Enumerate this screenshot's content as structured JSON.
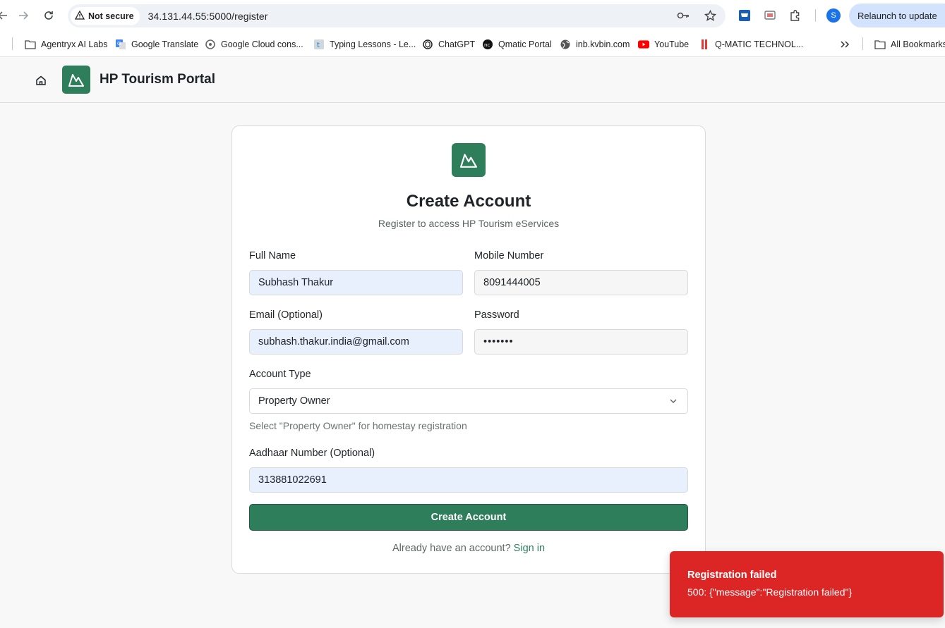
{
  "browser": {
    "security_label": "Not secure",
    "url": "34.131.44.55:5000/register",
    "profile_initial": "S",
    "relaunch_label": "Relaunch to update",
    "bookmarks": [
      {
        "label": "Agentryx AI Labs",
        "icon": "folder-icon"
      },
      {
        "label": "Google Translate",
        "icon": "translate-icon"
      },
      {
        "label": "Google Cloud cons...",
        "icon": "cloud-icon"
      },
      {
        "label": "Typing Lessons - Le...",
        "icon": "typing-icon"
      },
      {
        "label": "ChatGPT",
        "icon": "chatgpt-icon"
      },
      {
        "label": "Qmatic Portal",
        "icon": "qmatic-icon"
      },
      {
        "label": "inb.kvbin.com",
        "icon": "globe-icon"
      },
      {
        "label": "YouTube",
        "icon": "youtube-icon"
      },
      {
        "label": "Q-MATIC TECHNOL...",
        "icon": "qmatic-tech-icon"
      }
    ],
    "all_bookmarks_label": "All Bookmarks"
  },
  "header": {
    "title": "HP Tourism Portal"
  },
  "form": {
    "title": "Create Account",
    "subtitle": "Register to access HP Tourism eServices",
    "full_name_label": "Full Name",
    "full_name_value": "Subhash Thakur",
    "mobile_label": "Mobile Number",
    "mobile_value": "8091444005",
    "email_label": "Email (Optional)",
    "email_value": "subhash.thakur.india@gmail.com",
    "password_label": "Password",
    "password_value": "•••••••",
    "account_type_label": "Account Type",
    "account_type_value": "Property Owner",
    "account_type_hint": "Select \"Property Owner\" for homestay registration",
    "aadhaar_label": "Aadhaar Number (Optional)",
    "aadhaar_value": "313881022691",
    "submit_label": "Create Account",
    "signin_prompt": "Already have an account?",
    "signin_link": "Sign in"
  },
  "toast": {
    "title": "Registration failed",
    "message": "500: {\"message\":\"Registration failed\"}"
  },
  "colors": {
    "primary": "#2e7d5b",
    "error": "#dc2626",
    "autofill": "#e8f0fe"
  }
}
